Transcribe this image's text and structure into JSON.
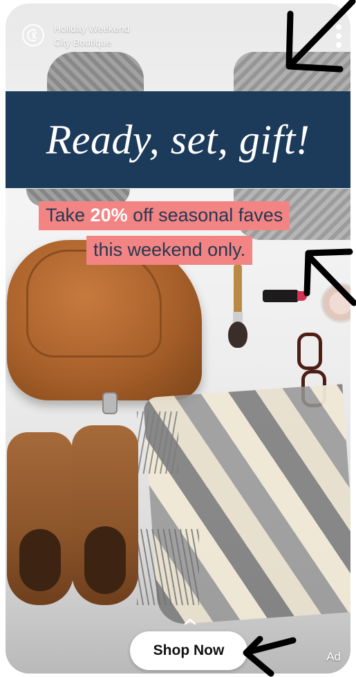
{
  "account": {
    "name": "Holiday Weekend",
    "subtitle": "City Boutique",
    "logo_icon": "boutique-logo-icon"
  },
  "banner": {
    "title": "Ready, set, gift!",
    "background": "#1c3a5a"
  },
  "promo": {
    "line1_prefix": "Take ",
    "line1_bold": "20%",
    "line1_suffix": " off seasonal faves",
    "line2": "this weekend only.",
    "highlight": "#f28484"
  },
  "cta": {
    "swipe_icon": "chevron-up-icon",
    "button_label": "Shop Now"
  },
  "ad_label": "Ad",
  "menu_icon": "more-vertical-icon"
}
